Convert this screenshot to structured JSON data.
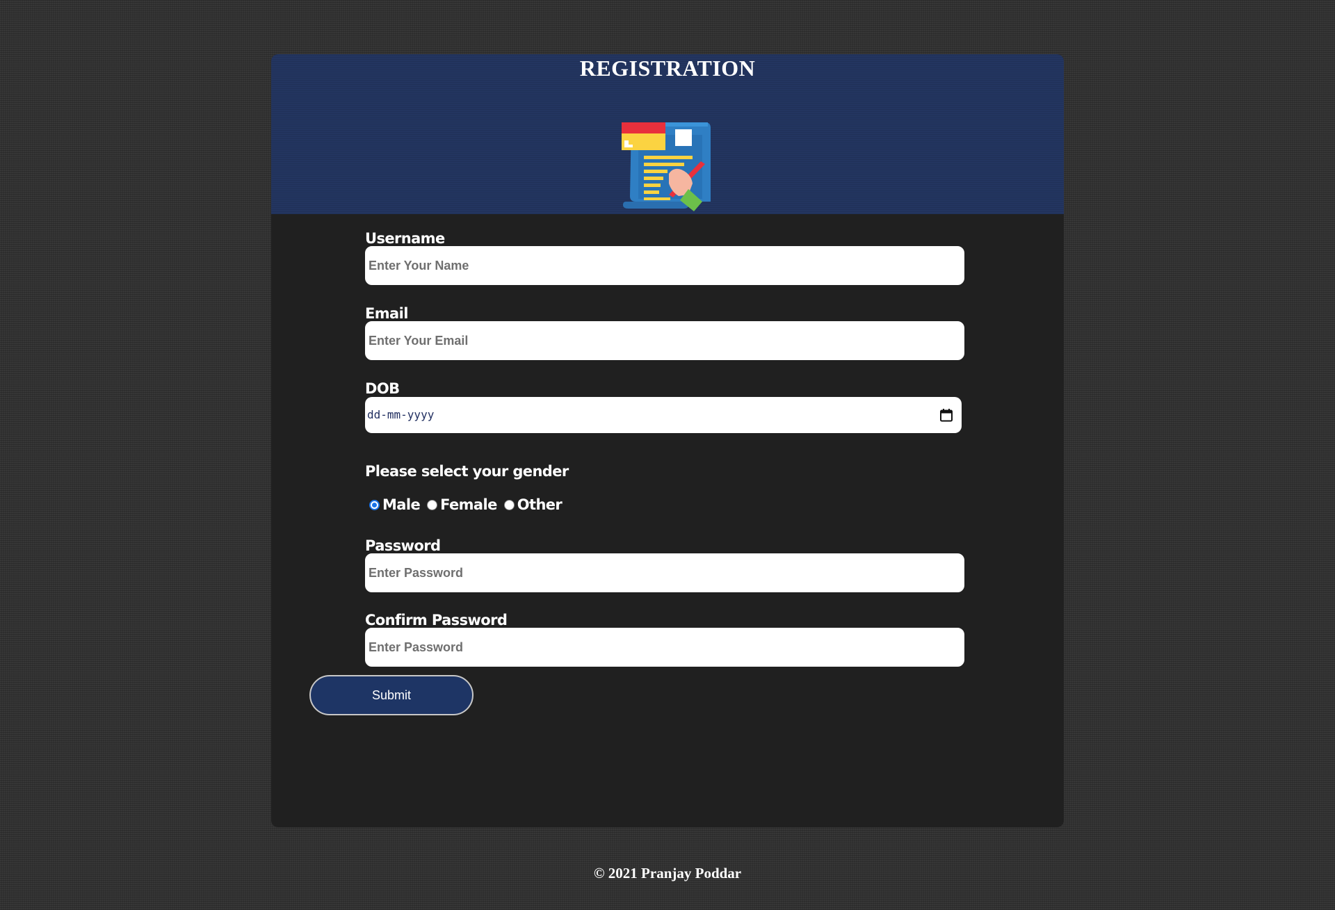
{
  "header": {
    "title": "REGISTRATION",
    "logo_icon": "registration-document-icon"
  },
  "form": {
    "username": {
      "label": "Username",
      "placeholder": "Enter Your Name",
      "value": ""
    },
    "email": {
      "label": "Email",
      "placeholder": "Enter Your Email",
      "value": ""
    },
    "dob": {
      "label": "DOB",
      "placeholder": "dd-mm-yyyy",
      "icon": "calendar-icon"
    },
    "gender": {
      "label": "Please select your gender",
      "options": [
        {
          "label": "Male",
          "checked": true
        },
        {
          "label": "Female",
          "checked": false
        },
        {
          "label": "Other",
          "checked": false
        }
      ]
    },
    "password": {
      "label": "Password",
      "placeholder": "Enter Password",
      "value": ""
    },
    "confirm_password": {
      "label": "Confirm Password",
      "placeholder": "Enter Password",
      "value": ""
    },
    "submit_label": "Submit"
  },
  "footer": {
    "text": "© 2021 Pranjay Poddar"
  },
  "colors": {
    "page_background": "#333333",
    "card_background": "#202020",
    "header_background": "#233560",
    "button_background": "#1e3565",
    "radio_accent": "#1a73e8"
  }
}
